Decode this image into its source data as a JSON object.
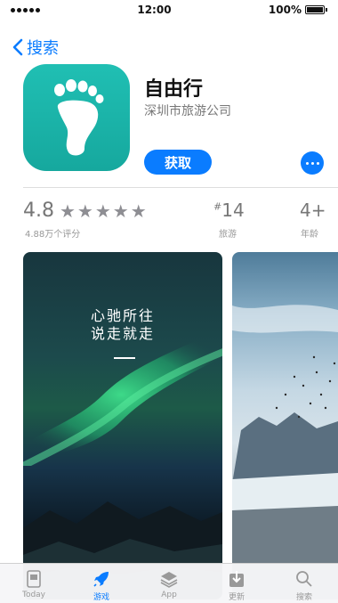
{
  "status": {
    "time": "12:00",
    "battery": "100%"
  },
  "nav": {
    "back_label": "搜索"
  },
  "app": {
    "name": "自由行",
    "developer": "深圳市旅游公司",
    "get_label": "获取",
    "icon": "footprint-icon"
  },
  "stats": {
    "rating": "4.8",
    "stars": "★★★★★",
    "rating_count": "4.88万个评分",
    "rank": "14",
    "rank_prefix": "#",
    "category": "旅游",
    "age": "4+",
    "age_label": "年龄"
  },
  "screenshots": [
    {
      "line1": "心驰所往",
      "line2": "说走就走"
    },
    {}
  ],
  "tabbar": {
    "items": [
      {
        "label": "Today",
        "icon": "today-icon"
      },
      {
        "label": "游戏",
        "icon": "rocket-icon"
      },
      {
        "label": "App",
        "icon": "layers-icon"
      },
      {
        "label": "更新",
        "icon": "download-icon"
      },
      {
        "label": "搜索",
        "icon": "search-icon"
      }
    ],
    "active_index": 1
  },
  "colors": {
    "accent": "#0a7cff",
    "app_icon": "#1bb5a9"
  }
}
